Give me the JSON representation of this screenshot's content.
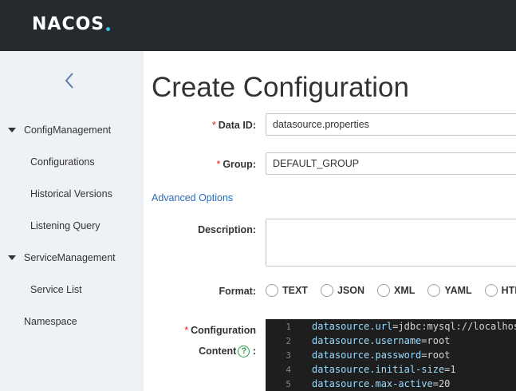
{
  "header": {
    "logo_text": "NACOS",
    "accent": "#2fc3e8"
  },
  "sidebar": {
    "collapse_icon": "chevron-left-icon",
    "groups": [
      {
        "label": "ConfigManagement",
        "items": [
          "Configurations",
          "Historical Versions",
          "Listening Query"
        ]
      },
      {
        "label": "ServiceManagement",
        "items": [
          "Service List"
        ]
      }
    ],
    "namespace": "Namespace"
  },
  "page": {
    "title": "Create Configuration"
  },
  "form": {
    "data_id_label": "Data ID:",
    "data_id_value": "datasource.properties",
    "group_label": "Group:",
    "group_value": "DEFAULT_GROUP",
    "advanced": "Advanced Options",
    "description_label": "Description:",
    "format_label": "Format:",
    "formats": [
      "TEXT",
      "JSON",
      "XML",
      "YAML",
      "HTML"
    ],
    "content_label_1": "Configuration",
    "content_label_2": "Content",
    "content_colon": ":",
    "required_mark": "*",
    "help_glyph": "?"
  },
  "editor": {
    "lines": [
      {
        "n": "1",
        "key": "datasource.url",
        "value": "jdbc:mysql://localhost"
      },
      {
        "n": "2",
        "key": "datasource.username",
        "value": "root"
      },
      {
        "n": "3",
        "key": "datasource.password",
        "value": "root"
      },
      {
        "n": "4",
        "key": "datasource.initial-size",
        "value": "1"
      },
      {
        "n": "5",
        "key": "datasource.max-active",
        "value": "20"
      }
    ],
    "eq": "="
  }
}
